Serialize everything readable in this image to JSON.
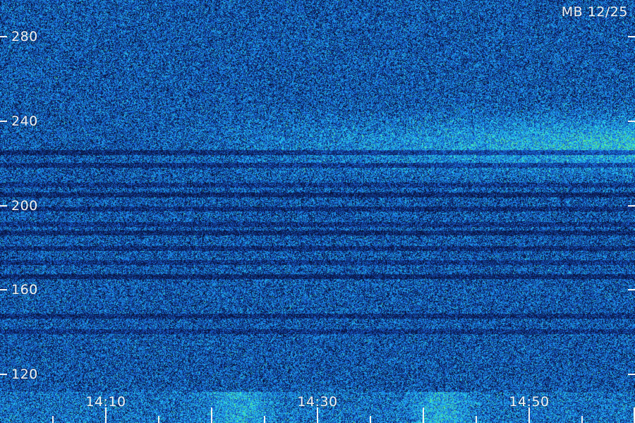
{
  "badge": "MB 12/25",
  "y_axis": {
    "ticks": [
      "280",
      "240",
      "200",
      "160",
      "120"
    ]
  },
  "x_axis": {
    "labels": [
      "14:10",
      "14:30",
      "14:50"
    ]
  },
  "colors": {
    "background": "#0a2060",
    "low": "#071b45",
    "mid": "#1f5fcf",
    "high": "#35d6e6",
    "peak": "#7cff70",
    "text": "#f2f2f2"
  }
}
